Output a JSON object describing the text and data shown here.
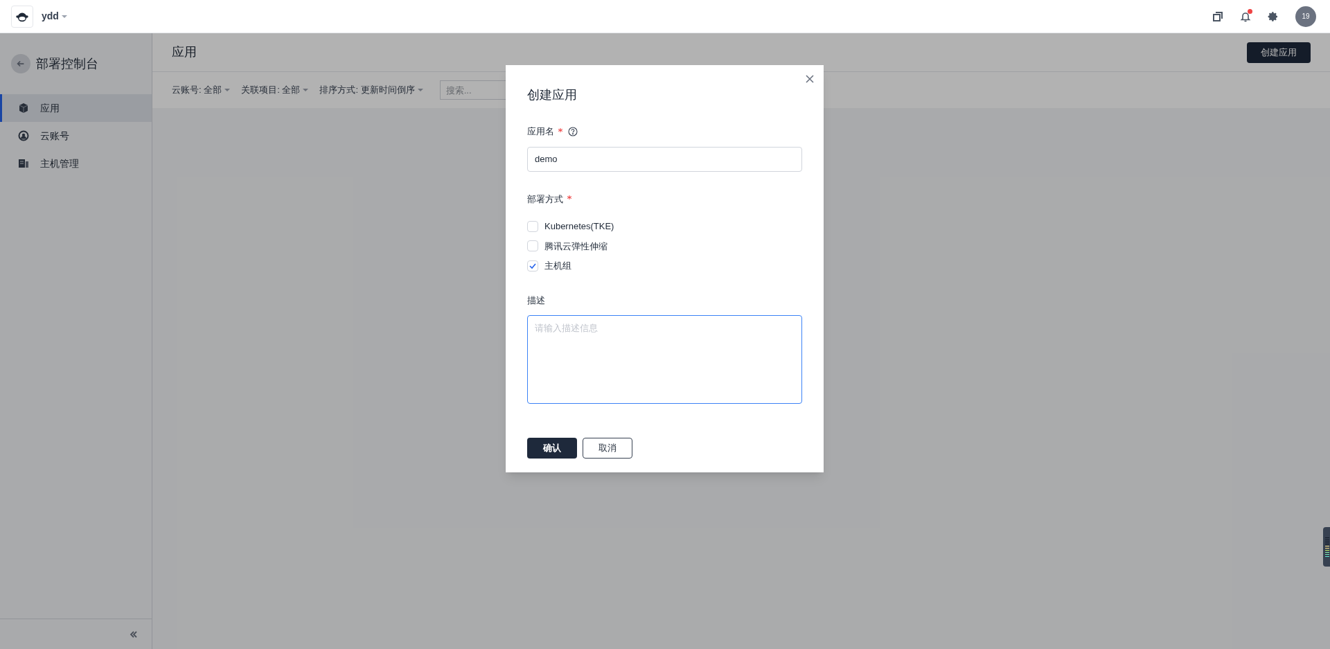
{
  "top_bar": {
    "workspace": "ydd",
    "notification_dot": true,
    "avatar": "19"
  },
  "sidebar": {
    "title": "部署控制台",
    "items": [
      {
        "label": "应用",
        "kind": "cube",
        "selected": true
      },
      {
        "label": "云账号",
        "kind": "account",
        "selected": false
      },
      {
        "label": "主机管理",
        "kind": "server",
        "selected": false
      }
    ]
  },
  "header": {
    "title": "应用",
    "create_button": "创建应用"
  },
  "filters": [
    {
      "label": "云账号:",
      "value": "全部"
    },
    {
      "label": "关联项目:",
      "value": "全部"
    },
    {
      "label": "排序方式:",
      "value": "更新时间倒序"
    }
  ],
  "search": {
    "placeholder": "搜索..."
  },
  "dialog": {
    "title": "创建应用",
    "name_field": {
      "label": "应用名",
      "required": true,
      "value": "demo"
    },
    "deploy": {
      "label": "部署方式",
      "required": true,
      "options": [
        {
          "label": "Kubernetes(TKE)",
          "checked": false
        },
        {
          "label": "腾讯云弹性伸缩",
          "checked": false
        },
        {
          "label": "主机组",
          "checked": true
        }
      ]
    },
    "description": {
      "label": "描述",
      "placeholder": "请输入描述信息"
    },
    "buttons": [
      {
        "label": "确认",
        "kind": "primary"
      },
      {
        "label": "取消",
        "kind": "secondary"
      }
    ]
  }
}
